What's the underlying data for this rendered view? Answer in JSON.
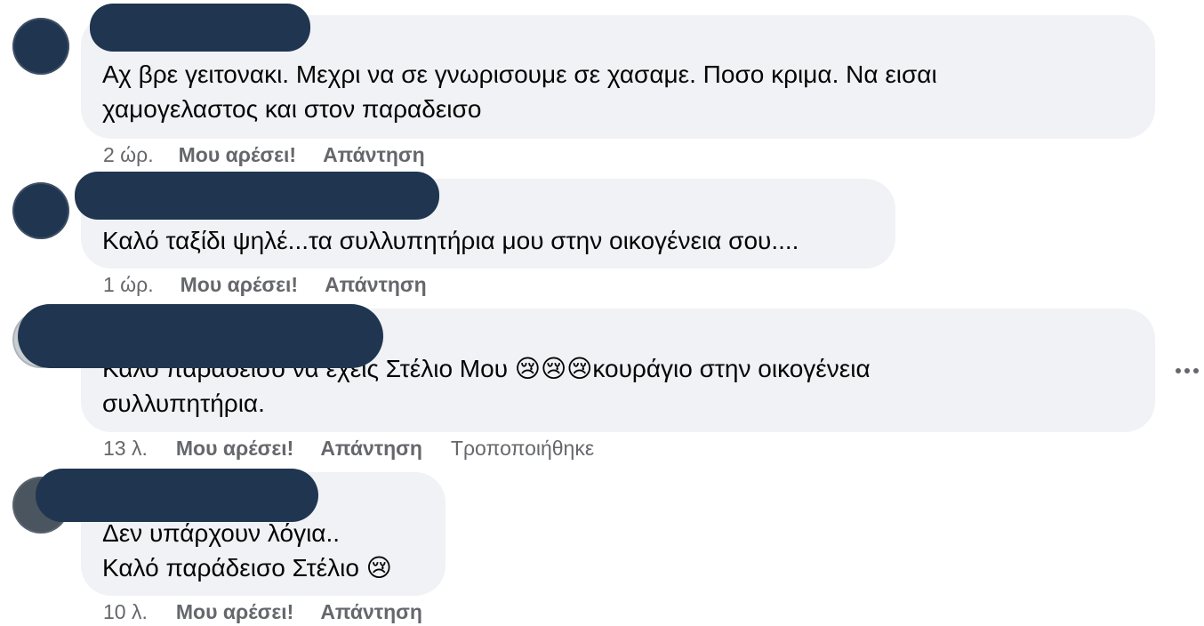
{
  "comments": [
    {
      "text": "Αχ βρε γειτονακι. Μεχρι να σε γνωρισουμε σε χασαμε. Ποσο κριμα. Να εισαι\nχαμογελαστος και στον παραδεισο",
      "time": "2 ώρ.",
      "like_label": "Μου αρέσει!",
      "reply_label": "Απάντηση"
    },
    {
      "text": "Καλό ταξίδι ψηλέ...τα συλλυπητήρια μου στην οικογένεια σου....",
      "time": "1 ώρ.",
      "like_label": "Μου αρέσει!",
      "reply_label": "Απάντηση"
    },
    {
      "text": "Καλό παράδεισο να έχεις Στέλιο Μου 😢😢😢κουράγιο στην οικογένεια\nσυλλυπητήρια.",
      "time": "13 λ.",
      "like_label": "Μου αρέσει!",
      "reply_label": "Απάντηση",
      "edited_label": "Τροποποιήθηκε"
    },
    {
      "text": "Δεν υπάρχουν λόγια..\nΚαλό παράδεισο Στέλιο 😢",
      "time": "10 λ.",
      "like_label": "Μου αρέσει!",
      "reply_label": "Απάντηση"
    }
  ],
  "icons": {
    "more": "more-options-icon"
  },
  "colors": {
    "bubble": "#f0f2f5",
    "redaction": "#1f3550",
    "meta_text": "#65676b",
    "body_text": "#050505"
  }
}
